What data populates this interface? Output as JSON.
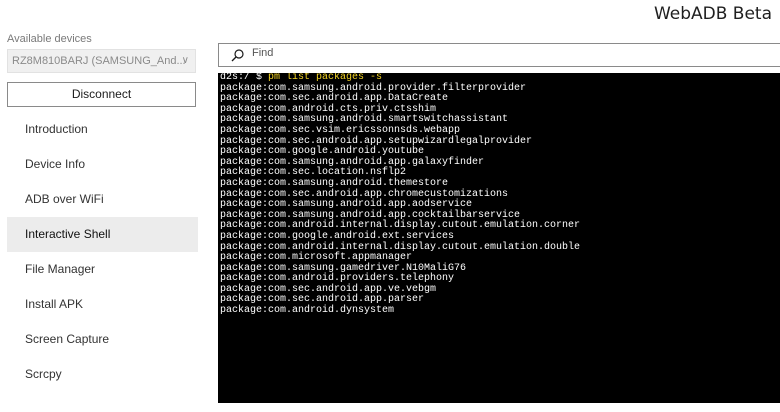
{
  "app": {
    "title": "WebADB Beta"
  },
  "sidebar": {
    "section_label": "Available devices",
    "device_selected": "RZ8M810BARJ (SAMSUNG_And...",
    "disconnect_label": "Disconnect",
    "items": [
      {
        "label": "Introduction",
        "active": false
      },
      {
        "label": "Device Info",
        "active": false
      },
      {
        "label": "ADB over WiFi",
        "active": false
      },
      {
        "label": "Interactive Shell",
        "active": true
      },
      {
        "label": "File Manager",
        "active": false
      },
      {
        "label": "Install APK",
        "active": false
      },
      {
        "label": "Screen Capture",
        "active": false
      },
      {
        "label": "Scrcpy",
        "active": false
      }
    ]
  },
  "main": {
    "find_placeholder": "Find",
    "terminal": {
      "prompt": "d2s:/ $ ",
      "command": "pm list packages -s",
      "lines": [
        "package:com.samsung.android.provider.filterprovider",
        "package:com.sec.android.app.DataCreate",
        "package:com.android.cts.priv.ctsshim",
        "package:com.samsung.android.smartswitchassistant",
        "package:com.sec.vsim.ericssonnsds.webapp",
        "package:com.sec.android.app.setupwizardlegalprovider",
        "package:com.google.android.youtube",
        "package:com.samsung.android.app.galaxyfinder",
        "package:com.sec.location.nsflp2",
        "package:com.samsung.android.themestore",
        "package:com.sec.android.app.chromecustomizations",
        "package:com.samsung.android.app.aodservice",
        "package:com.samsung.android.app.cocktailbarservice",
        "package:com.android.internal.display.cutout.emulation.corner",
        "package:com.google.android.ext.services",
        "package:com.android.internal.display.cutout.emulation.double",
        "package:com.microsoft.appmanager",
        "package:com.samsung.gamedriver.N10MaliG76",
        "package:com.android.providers.telephony",
        "package:com.sec.android.app.ve.vebgm",
        "package:com.sec.android.app.parser",
        "package:com.android.dynsystem"
      ]
    }
  },
  "colors": {
    "terminal_bg": "#000000",
    "command_highlight": "#f3d324",
    "active_nav_bg": "#ececec"
  }
}
